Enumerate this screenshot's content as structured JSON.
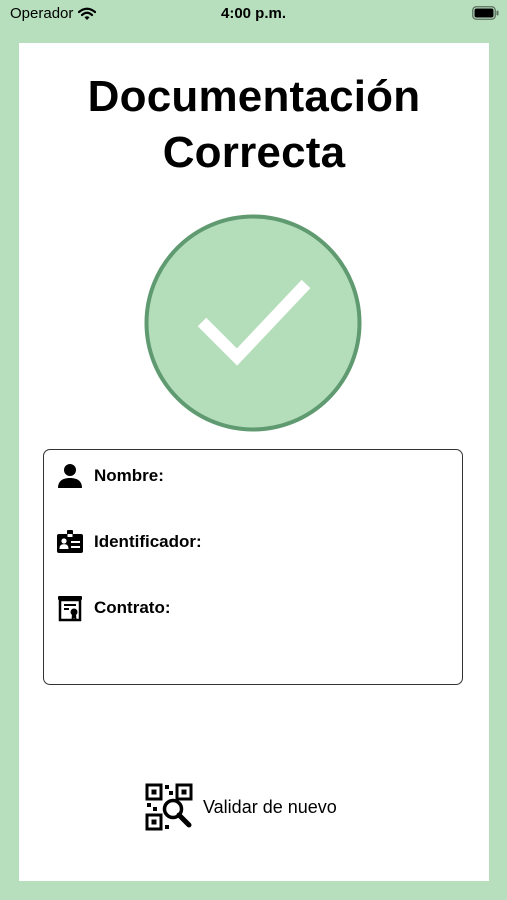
{
  "status_bar": {
    "carrier": "Operador",
    "time": "4:00 p.m.",
    "wifi_icon": "wifi-icon",
    "battery_icon": "battery-icon"
  },
  "title": {
    "line1": "Documentación",
    "line2": "Correcta"
  },
  "status_icon": "checkmark-circle-icon",
  "colors": {
    "background": "#b7dfbd",
    "circle_fill": "#b4deba",
    "circle_stroke": "#5f9a70",
    "check": "#ffffff"
  },
  "info": {
    "nombre_label": "Nombre:",
    "identificador_label": "Identificador:",
    "contrato_label": "Contrato:"
  },
  "actions": {
    "revalidate_label": "Validar de nuevo",
    "revalidate_icon": "qr-search-icon"
  }
}
